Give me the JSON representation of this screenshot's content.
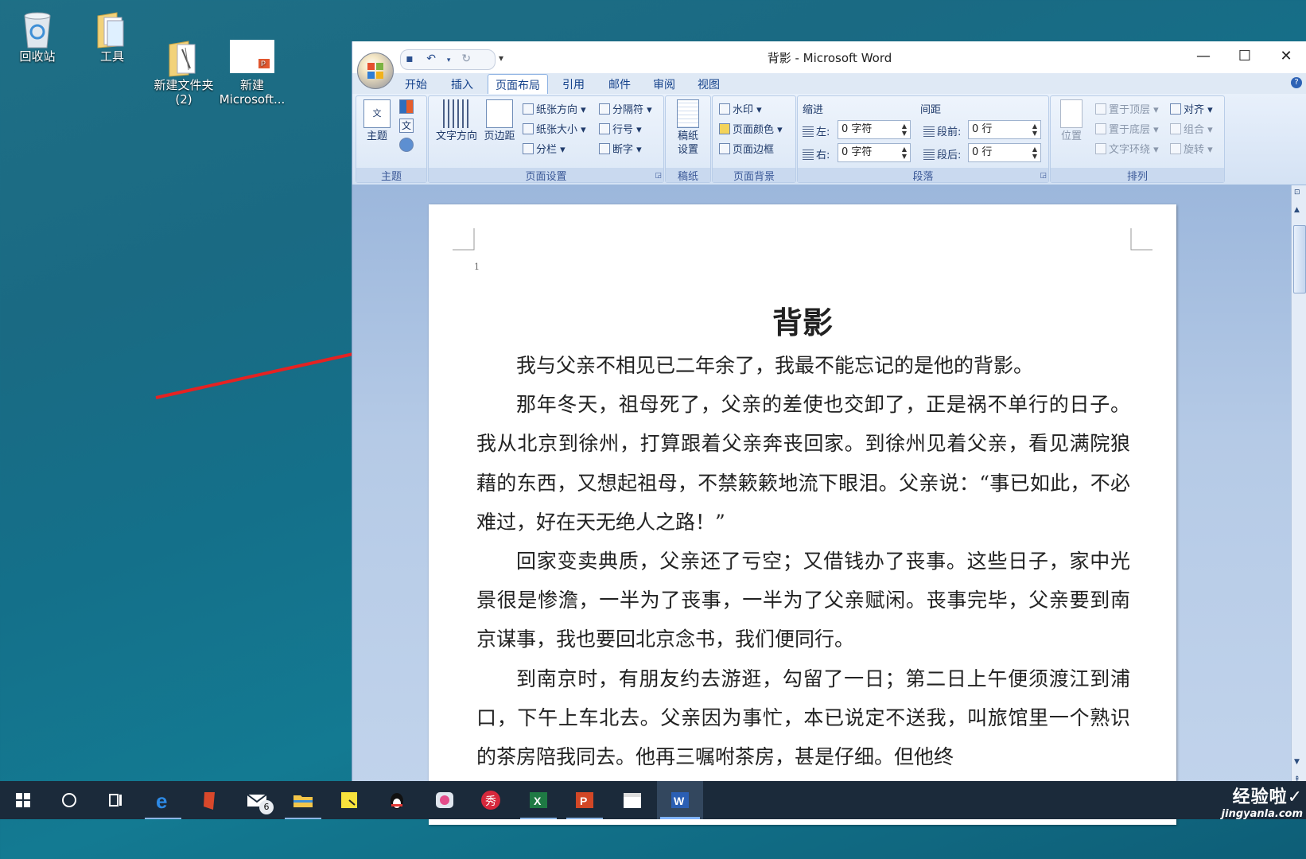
{
  "desktop": {
    "icons": [
      {
        "label": "回收站",
        "icon": "recycle-bin-icon"
      },
      {
        "label": "工具",
        "icon": "folder-icon"
      },
      {
        "label": "新建文件夹\n(2)",
        "icon": "folder-icon"
      },
      {
        "label": "新建\nMicrosoft...",
        "icon": "powerpoint-file-icon"
      }
    ],
    "annotation_color": "#e52222"
  },
  "window": {
    "title": "背影 - Microsoft Word",
    "controls": {
      "minimize": "—",
      "maximize": "☐",
      "close": "✕"
    },
    "qat": {
      "more": "▾"
    }
  },
  "tabs": [
    "开始",
    "插入",
    "页面布局",
    "引用",
    "邮件",
    "审阅",
    "视图"
  ],
  "active_tab": "页面布局",
  "ribbon": {
    "theme": {
      "label": "主题",
      "button": "主题"
    },
    "page_setup": {
      "label": "页面设置",
      "text_direction": "文字方向",
      "margins": "页边距",
      "orientation": "纸张方向",
      "size": "纸张大小",
      "columns": "分栏",
      "breaks": "分隔符",
      "line_numbers": "行号",
      "hyphenation": "断字"
    },
    "draft": {
      "label": "稿纸",
      "button_line1": "稿纸",
      "button_line2": "设置"
    },
    "page_background": {
      "label": "页面背景",
      "watermark": "水印",
      "page_color": "页面颜色",
      "page_borders": "页面边框"
    },
    "paragraph": {
      "label": "段落",
      "indent": "缩进",
      "spacing": "间距",
      "left_label": "左:",
      "left_value": "0 字符",
      "right_label": "右:",
      "right_value": "0 字符",
      "before_label": "段前:",
      "before_value": "0 行",
      "after_label": "段后:",
      "after_value": "0 行"
    },
    "arrange": {
      "label": "排列",
      "position": "位置",
      "bring_front": "置于顶层",
      "send_back": "置于底层",
      "text_wrap": "文字环绕",
      "align": "对齐",
      "group": "组合",
      "rotate": "旋转"
    }
  },
  "document": {
    "line_number": "1",
    "title": "背影",
    "paragraphs": [
      "我与父亲不相见已二年余了，我最不能忘记的是他的背影。",
      "那年冬天，祖母死了，父亲的差使也交卸了，正是祸不单行的日子。我从北京到徐州，打算跟着父亲奔丧回家。到徐州见着父亲，看见满院狼藉的东西，又想起祖母，不禁簌簌地流下眼泪。父亲说：“事已如此，不必难过，好在天无绝人之路！”",
      "回家变卖典质，父亲还了亏空；又借钱办了丧事。这些日子，家中光景很是惨澹，一半为了丧事，一半为了父亲赋闲。丧事完毕，父亲要到南京谋事，我也要回北京念书，我们便同行。",
      "到南京时，有朋友约去游逛，勾留了一日；第二日上午便须渡江到浦口，下午上车北去。父亲因为事忙，本已说定不送我，叫旅馆里一个熟识的茶房陪我同去。他再三嘱咐茶房，甚是仔细。但他终"
    ]
  },
  "taskbar": {
    "items": [
      "start",
      "cortana",
      "task-view",
      "edge",
      "app-red",
      "mail",
      "file-explorer",
      "sticky-notes",
      "qq",
      "app-pink",
      "xiu",
      "excel",
      "powerpoint",
      "video",
      "word"
    ],
    "mail_badge": "6"
  },
  "watermark": {
    "line1": "经验啦✓",
    "line2": "jingyanla.com"
  }
}
